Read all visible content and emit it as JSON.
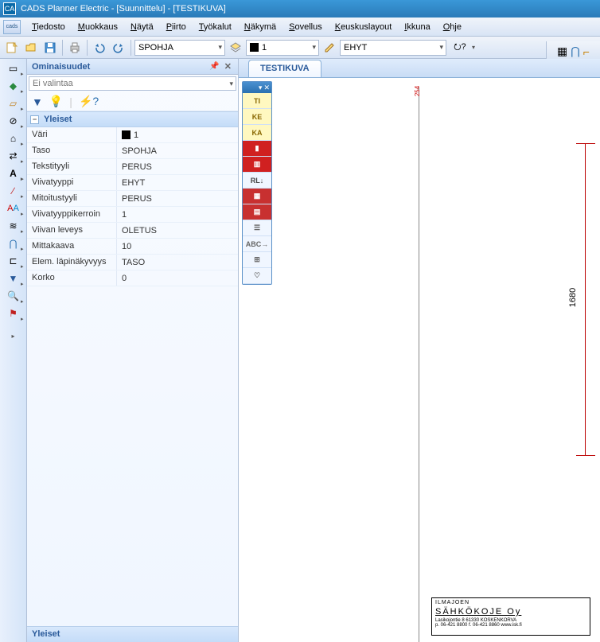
{
  "title": "CADS Planner Electric - [Suunnittelu] - [TESTIKUVA]",
  "logo_text": "CA",
  "menu": {
    "mini_btn": "cads",
    "items": [
      {
        "u": "T",
        "rest": "iedosto"
      },
      {
        "u": "M",
        "rest": "uokkaus"
      },
      {
        "u": "N",
        "rest": "äytä"
      },
      {
        "u": "P",
        "rest": "iirto"
      },
      {
        "u": "T",
        "rest": "yökalut"
      },
      {
        "u": "N",
        "rest": "äkymä"
      },
      {
        "u": "S",
        "rest": "ovellus"
      },
      {
        "u": "K",
        "rest": "euskuslayout"
      },
      {
        "u": "I",
        "rest": "kkuna"
      },
      {
        "u": "O",
        "rest": "hje"
      }
    ]
  },
  "toolbar": {
    "layer_combo": "SPOHJA",
    "color_combo": "1",
    "linetype_combo": "EHYT"
  },
  "right_tb_icons": [
    "grid-icon",
    "snap-icon",
    "angle-icon"
  ],
  "panel": {
    "title": "Ominaisuudet",
    "selection": "Ei valintaa",
    "group": "Yleiset",
    "rows": [
      {
        "name": "Väri",
        "value": "1",
        "swatch": true
      },
      {
        "name": "Taso",
        "value": "SPOHJA"
      },
      {
        "name": "Tekstityyli",
        "value": "PERUS"
      },
      {
        "name": "Viivatyyppi",
        "value": "EHYT"
      },
      {
        "name": "Mitoitustyyli",
        "value": "PERUS"
      },
      {
        "name": "Viivatyyppikerroin",
        "value": "1"
      },
      {
        "name": "Viivan leveys",
        "value": "OLETUS"
      },
      {
        "name": "Mittakaava",
        "value": "10"
      },
      {
        "name": "Elem. läpinäkyvyys",
        "value": "TASO"
      },
      {
        "name": "Korko",
        "value": "0"
      }
    ],
    "footer": "Yleiset"
  },
  "doc_tab": "TESTIKUVA",
  "palette_items": [
    {
      "label": "TI",
      "bg": "#fff8c0",
      "fg": "#886600"
    },
    {
      "label": "KE",
      "bg": "#fff8c0",
      "fg": "#886600"
    },
    {
      "label": "KA",
      "bg": "#fff8c0",
      "fg": "#886600"
    },
    {
      "label": "▮",
      "bg": "#d02020",
      "fg": "#fff"
    },
    {
      "label": "▥",
      "bg": "#d02020",
      "fg": "#fff"
    },
    {
      "label": "RL↓",
      "bg": "#f0f6ff",
      "fg": "#444"
    },
    {
      "label": "▦",
      "bg": "#c83030",
      "fg": "#fff"
    },
    {
      "label": "▤",
      "bg": "#c83030",
      "fg": "#fff"
    },
    {
      "label": "☰",
      "bg": "#f0f6ff",
      "fg": "#666"
    },
    {
      "label": "ABC→",
      "bg": "#f0f6ff",
      "fg": "#666"
    },
    {
      "label": "⊞",
      "bg": "#f0f6ff",
      "fg": "#666"
    },
    {
      "label": "♡",
      "bg": "#f0f6ff",
      "fg": "#666"
    }
  ],
  "dimension_value": "1680",
  "red_annotation": "254",
  "title_block": {
    "top": "ILMAJOEN",
    "company": "SÄHKÖKOJE Oy",
    "addr": "Lasikojontie 8  61330 KOSKENKORVA",
    "phone": "p. 06-421 8800   f. 06-421 8860   www.isk.fi"
  }
}
